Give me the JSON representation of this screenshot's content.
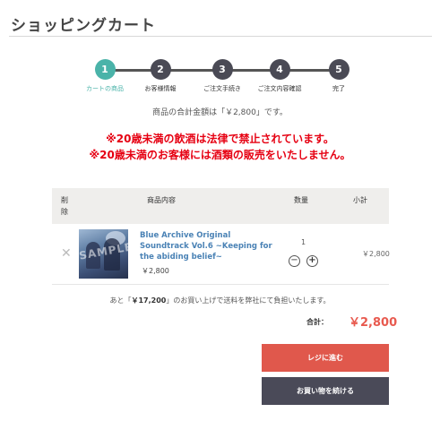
{
  "page": {
    "title": "ショッピングカート"
  },
  "steps": [
    {
      "num": "1",
      "label": "カートの商品",
      "active": true
    },
    {
      "num": "2",
      "label": "お客様情報",
      "active": false
    },
    {
      "num": "3",
      "label": "ご注文手続き",
      "active": false
    },
    {
      "num": "4",
      "label": "ご注文内容確認",
      "active": false
    },
    {
      "num": "5",
      "label": "完了",
      "active": false
    }
  ],
  "summary": {
    "total_message": "商品の合計金額は「￥2,800」です。"
  },
  "warnings": [
    "※20歳未満の飲酒は法律で禁止されています。",
    "※20歳未満のお客様には酒類の販売をいたしません。"
  ],
  "table": {
    "headers": {
      "delete": "削除",
      "product": "商品内容",
      "quantity": "数量",
      "subtotal": "小計"
    },
    "items": [
      {
        "name": "Blue Archive Original Soundtrack Vol.6 ~Keeping for the abiding belief~",
        "price": "￥2,800",
        "quantity": "1",
        "subtotal": "￥2,800",
        "thumbnail_watermark": "SAMPLE"
      }
    ]
  },
  "shipping": {
    "prefix": "あと「",
    "amount": "￥17,200",
    "suffix": "」のお買い上げで送料を弊社にて負担いたします。"
  },
  "cart_total": {
    "label": "合計：",
    "value": "￥2,800"
  },
  "buttons": {
    "checkout": "レジに進む",
    "continue": "お買い物を続ける"
  },
  "colors": {
    "accent_teal": "#4ab3a9",
    "warning_red": "#e60012",
    "price_red": "#e85a4f",
    "checkout_bg": "#e0584c",
    "continue_bg": "#4a4a58",
    "link_blue": "#4a82b5"
  }
}
